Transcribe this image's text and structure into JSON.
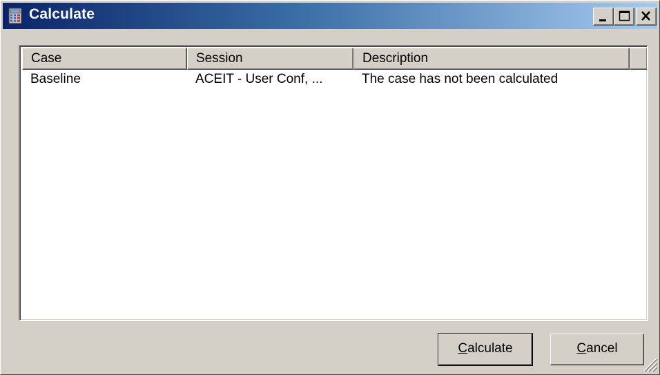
{
  "window": {
    "title": "Calculate",
    "title_icon": "calculator-icon",
    "controls": [
      "minimize-icon",
      "maximize-icon",
      "close-icon"
    ]
  },
  "list": {
    "columns": [
      "Case",
      "Session",
      "Description"
    ],
    "rows": [
      {
        "case": "Baseline",
        "session": "ACEIT - User Conf, ...",
        "description": "The case has not been calculated"
      }
    ]
  },
  "buttons": {
    "calculate": {
      "accel": "C",
      "rest": "alculate"
    },
    "cancel": {
      "accel": "C",
      "rest": "ancel"
    }
  },
  "colors": {
    "title_gradient_start": "#0a246a",
    "title_gradient_end": "#a6caf0",
    "face": "#d4d0c8"
  }
}
